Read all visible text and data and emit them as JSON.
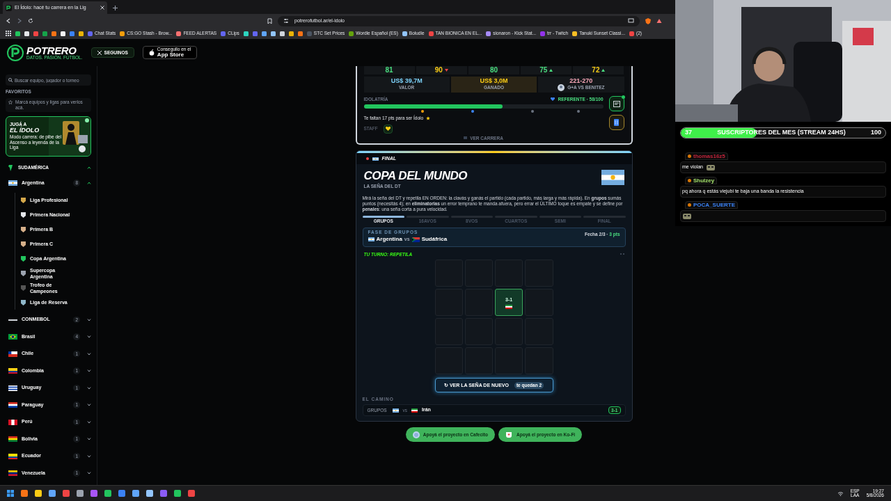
{
  "browser": {
    "tab_title": "El Ídolo: hacé tu carrera en la Lig",
    "url": "potrerofutbol.ar/el-idolo",
    "bookmarks": [
      {
        "kind": "icon",
        "color": "#22c55e"
      },
      {
        "kind": "icon",
        "color": "#e5e7eb"
      },
      {
        "kind": "icon",
        "color": "#ef4444"
      },
      {
        "kind": "icon",
        "color": "#16a34a"
      },
      {
        "kind": "icon",
        "color": "#f97316"
      },
      {
        "kind": "icon",
        "color": "#f3f4f6"
      },
      {
        "kind": "icon",
        "color": "#3b82f6"
      },
      {
        "kind": "icon",
        "color": "#eab308"
      },
      {
        "label": "Chat Stats",
        "kind": "link",
        "color": "#6366f1"
      },
      {
        "label": "CS:GO Stash - Brow...",
        "kind": "link",
        "color": "#f59e0b"
      },
      {
        "label": "FEED ALERTAS",
        "kind": "link",
        "color": "#f87171"
      },
      {
        "label": "CLips",
        "kind": "link",
        "color": "#6366f1"
      },
      {
        "kind": "icon",
        "color": "#2dd4bf"
      },
      {
        "kind": "icon",
        "color": "#6366f1"
      },
      {
        "kind": "icon",
        "color": "#60a5fa"
      },
      {
        "kind": "icon",
        "color": "#93c5fd"
      },
      {
        "kind": "icon",
        "color": "#d1d5db"
      },
      {
        "kind": "icon",
        "color": "#eab308"
      },
      {
        "kind": "icon",
        "color": "#f97316"
      },
      {
        "label": "STC Set Prices",
        "kind": "link",
        "color": "#4b5563"
      },
      {
        "label": "Wordle Español (ES)",
        "kind": "link",
        "color": "#65a30d"
      },
      {
        "label": "Boludle",
        "kind": "link",
        "color": "#93c5fd"
      },
      {
        "label": "TAN BIONICA EN EL...",
        "kind": "link",
        "color": "#ef4444"
      },
      {
        "label": "sionaron - Kick Stat...",
        "kind": "link",
        "color": "#a78bfa"
      },
      {
        "label": "trr - Twitch",
        "kind": "link",
        "color": "#9333ea"
      },
      {
        "label": "Tanuki Sunset Classi...",
        "kind": "link",
        "color": "#fbbf24"
      },
      {
        "label": "(2)",
        "kind": "link",
        "color": "#ef4444"
      }
    ]
  },
  "header": {
    "brand": "POTRERO",
    "tagline": "DATOS. PASIÓN. FÚTBOL.",
    "follow_button": "SEGUINOS",
    "store_small": "Conseguilo en el",
    "store_big": "App Store"
  },
  "sidebar": {
    "search_placeholder": "Buscar equipo, jugador o torneo",
    "favorites_title": "FAVORITOS",
    "favorites_hint": "Marcá equipos y ligas para verlos acá.",
    "promo": {
      "kicker": "JUGÁ A",
      "title": "EL ÍDOLO",
      "text": "Modo carrera: de pibe del Ascenso a leyenda de la Liga"
    },
    "region": {
      "label": "SUDAMÉRICA",
      "expanded": true
    },
    "tree": [
      {
        "label": "Argentina",
        "kind": "ar",
        "count": "8",
        "expanded": true,
        "children": [
          {
            "label": "Liga Profesional"
          },
          {
            "label": "Primera Nacional"
          },
          {
            "label": "Primera B"
          },
          {
            "label": "Primera C"
          },
          {
            "label": "Copa Argentina"
          },
          {
            "label": "Supercopa Argentina"
          },
          {
            "label": "Trofeo de Campeones"
          },
          {
            "label": "Liga de Reserva"
          }
        ]
      },
      {
        "label": "CONMEBOL",
        "kind": "conmebol",
        "count": "2",
        "expanded": false
      },
      {
        "label": "Brasil",
        "kind": "br",
        "count": "4",
        "expanded": false
      },
      {
        "label": "Chile",
        "kind": "cl",
        "count": "1",
        "expanded": false
      },
      {
        "label": "Colombia",
        "kind": "co",
        "count": "1",
        "expanded": false
      },
      {
        "label": "Uruguay",
        "kind": "uy",
        "count": "1",
        "expanded": false
      },
      {
        "label": "Paraguay",
        "kind": "py",
        "count": "1",
        "expanded": false
      },
      {
        "label": "Perú",
        "kind": "pe",
        "count": "1",
        "expanded": false
      },
      {
        "label": "Bolivia",
        "kind": "bo",
        "count": "1",
        "expanded": false
      },
      {
        "label": "Ecuador",
        "kind": "ec",
        "count": "1",
        "expanded": false
      },
      {
        "label": "Venezuela",
        "kind": "ve",
        "count": "1",
        "expanded": false
      }
    ]
  },
  "career": {
    "stats": [
      {
        "value": "81",
        "color": "#4ade80",
        "kind": "flat"
      },
      {
        "value": "90",
        "color": "#facc15",
        "kind": "down"
      },
      {
        "value": "80",
        "color": "#4ade80",
        "kind": "flat"
      },
      {
        "value": "75",
        "color": "#4ade80",
        "kind": "up"
      },
      {
        "value": "72",
        "color": "#facc15",
        "kind": "up"
      }
    ],
    "money": [
      {
        "value": "US$ 39,7M",
        "label": "VALOR",
        "kind": "value"
      },
      {
        "value": "US$ 3,0M",
        "label": "GANADO",
        "kind": "earned"
      },
      {
        "value": "221-270",
        "label": "G+A VS BENITEZ",
        "kind": "rival"
      }
    ],
    "idolatry": {
      "label": "IDOLATRÍA",
      "rank": "REFERENTE · 58/100",
      "level": 0.58,
      "hint": "Te faltan 17 pts para ser Ídolo"
    },
    "staff_label": "STAFF",
    "link": "VER CARRERA"
  },
  "match": {
    "badge": "FINAL",
    "title": "COPA DEL MUNDO",
    "subtitle": "LA SEÑA DEL DT",
    "description": "Mirá la seña del DT y repetila EN ORDEN: la clavás y ganás el partido (cada partido, más larga y más rápida). En **grupos** sumás puntos (necesitás 4); en **eliminatorias** un error temprano te manda afuera, pero errar el ÚLTIMO toque es empate y se define por **penales**: una seña corta a pura velocidad.",
    "stages": [
      {
        "label": "GRUPOS",
        "selected": true
      },
      {
        "label": "16AVOS",
        "selected": false
      },
      {
        "label": "8VOS",
        "selected": false
      },
      {
        "label": "CUARTOS",
        "selected": false
      },
      {
        "label": "SEMI",
        "selected": false
      },
      {
        "label": "FINAL",
        "selected": false
      }
    ],
    "phase": "FASE DE GRUPOS",
    "home": "Argentina",
    "vs": "vs",
    "away": "Sudáfrica",
    "fixture": "Fecha 2/3 · ",
    "points": "3 pts",
    "turn": "TU TURNO: REPETILA",
    "cells": [
      {
        "lit": false
      },
      {
        "lit": false
      },
      {
        "lit": false
      },
      {
        "lit": false
      },
      {
        "lit": false
      },
      {
        "lit": false
      },
      {
        "lit": true,
        "score": "3-1",
        "kind": "ir"
      },
      {
        "lit": false
      },
      {
        "lit": false
      },
      {
        "lit": false
      },
      {
        "lit": false
      },
      {
        "lit": false
      },
      {
        "lit": false
      },
      {
        "lit": false
      },
      {
        "lit": false
      },
      {
        "lit": false
      }
    ],
    "replay_button": "↻ VER LA SEÑA DE NUEVO",
    "replay_badge": "te quedan 2",
    "path_title": "EL CAMINO",
    "path": [
      {
        "stage": "GRUPOS",
        "vs": "vs",
        "rival": "Irán",
        "kind": "ir",
        "score": "3-1"
      }
    ]
  },
  "support": [
    {
      "label": "Apoyá el proyecto en Cafecito",
      "kind": "cafecito"
    },
    {
      "label": "Apoyá el proyecto en Ko-Fi",
      "kind": "kofi"
    }
  ],
  "stream": {
    "goal": {
      "current": "37",
      "title": "SUSCRIPTORES DEL MES (STREAM 24HS)",
      "target": "100",
      "level": 0.37
    },
    "chat": [
      {
        "user": "thomas16z5",
        "color": "#c0243b",
        "text": "me violan",
        "emote": true
      },
      {
        "user": "Shulzey",
        "color": "#a3e06a",
        "text": "pq ahora q estás viejubi te baja una banda la resistencia",
        "emote": false
      },
      {
        "user": "POCA_SUERTE",
        "color": "#3b82f6",
        "emote": true
      }
    ]
  },
  "taskbar": {
    "lang": "ESP",
    "layout": "LAA",
    "time": "19:27",
    "date": "5/8/2026"
  }
}
